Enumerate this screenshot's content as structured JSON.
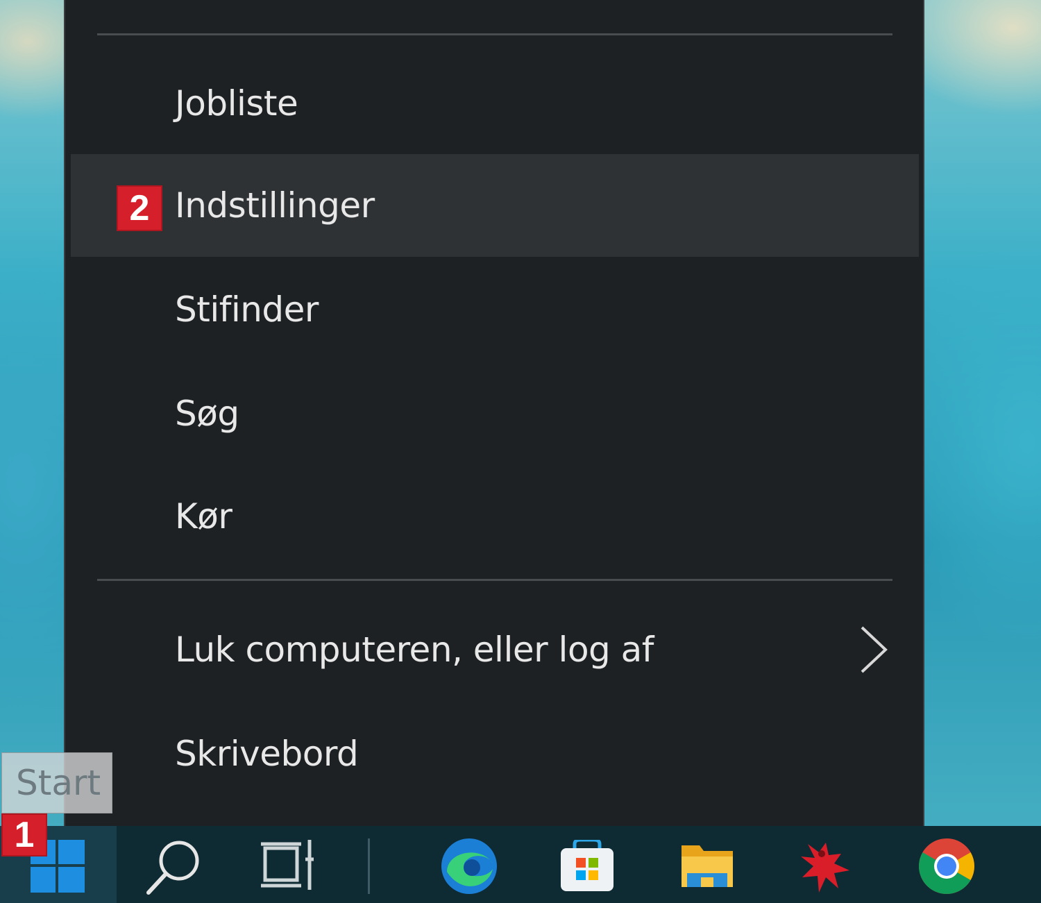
{
  "menu": {
    "items": [
      {
        "label": "Jobliste"
      },
      {
        "label": "Indstillinger",
        "badge": "2"
      },
      {
        "label": "Stifinder"
      },
      {
        "label": "Søg"
      },
      {
        "label": "Kør"
      },
      {
        "label": "Luk computeren, eller log af"
      },
      {
        "label": "Skrivebord"
      }
    ]
  },
  "tooltip": {
    "text": "Start"
  },
  "taskbar": {
    "start_badge": "1",
    "icons": [
      "windows-start-icon",
      "search-icon",
      "task-view-icon",
      "edge-icon",
      "microsoft-store-icon",
      "file-explorer-icon",
      "red-app-icon",
      "chrome-icon"
    ]
  },
  "colors": {
    "menu_bg": "#1e2124",
    "menu_hover": "#2f3234",
    "badge_red": "#d51f2a",
    "taskbar_bg": "#0e2a33",
    "windows_blue": "#1e8fe0"
  }
}
